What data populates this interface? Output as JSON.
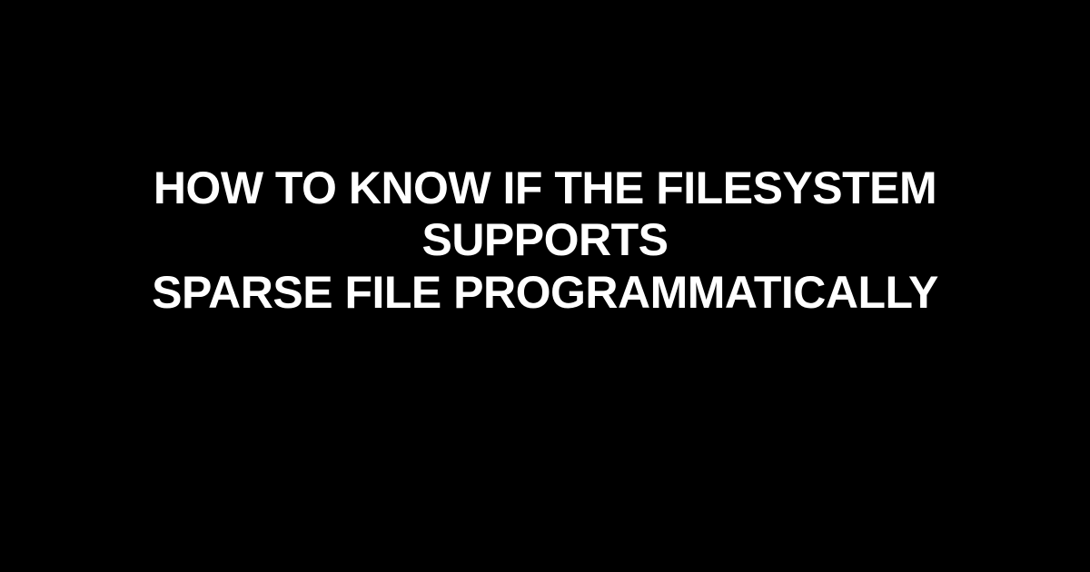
{
  "document": {
    "title_line1": "How to know if the filesystem supports",
    "title_line2": "sparse file programmatically"
  }
}
